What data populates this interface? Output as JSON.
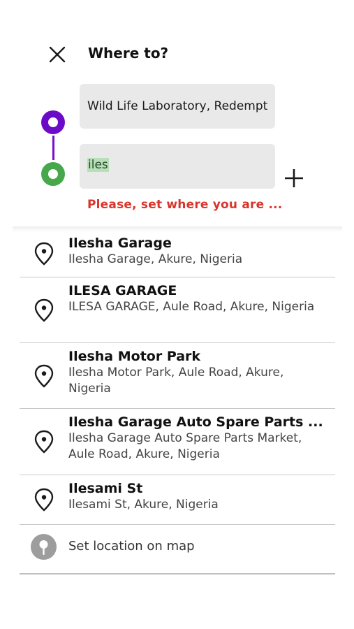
{
  "header": {
    "title": "Where to?"
  },
  "route": {
    "origin_value": "Wild Life Laboratory, Redempt",
    "destination_value": "iles",
    "error_text": "Please, set where you are ..."
  },
  "results": [
    {
      "name": "Ilesha Garage",
      "address": "Ilesha Garage, Akure, Nigeria"
    },
    {
      "name": "ILESA GARAGE",
      "address": "ILESA GARAGE, Aule Road, Akure, Nigeria"
    },
    {
      "name": "Ilesha Motor Park",
      "address": "Ilesha Motor Park, Aule Road, Akure, Nigeria"
    },
    {
      "name": "Ilesha Garage Auto Spare Parts ...",
      "address": "Ilesha Garage Auto Spare Parts Market, Aule Road, Akure, Nigeria"
    },
    {
      "name": "Ilesami St",
      "address": "Ilesami St, Akure, Nigeria"
    }
  ],
  "map_option": {
    "label": "Set location on map"
  },
  "colors": {
    "origin": "#6c0bc7",
    "destination": "#46a84a",
    "error": "#d9342b"
  },
  "icons": {
    "close": "close-icon",
    "add": "plus-icon",
    "result": "map-pin-icon",
    "map": "map-pin-filled-icon"
  }
}
